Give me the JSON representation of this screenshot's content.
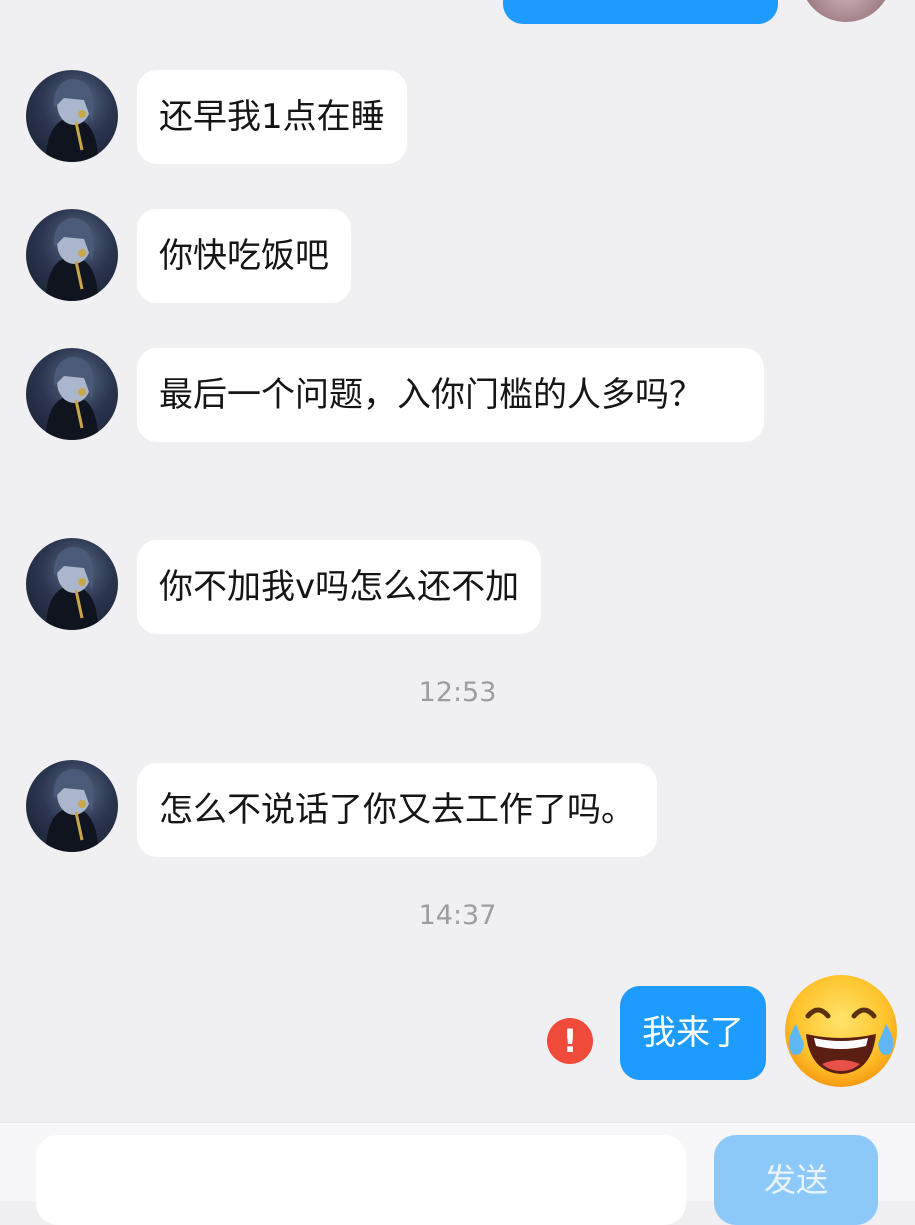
{
  "messages": {
    "partial_top": "",
    "m1": "还早我1点在睡",
    "m2": "你快吃饭吧",
    "m3": "最后一个问题，入你门槛的人多吗？",
    "m4": "你不加我v吗怎么还不加",
    "m5": "怎么不说话了你又去工作了吗。",
    "m6": "我来了"
  },
  "timestamps": {
    "t1": "12:53",
    "t2": "14:37"
  },
  "status": {
    "send_failed_icon": "exclamation-icon",
    "send_failed_symbol": "!"
  },
  "input": {
    "value": "",
    "placeholder": ""
  },
  "send_button": {
    "label": "发送"
  },
  "colors": {
    "background": "#f0f0f3",
    "incoming_bubble": "#ffffff",
    "outgoing_bubble": "#1e9bff",
    "send_button_disabled": "#8cc8f8",
    "error": "#f04a3a"
  }
}
